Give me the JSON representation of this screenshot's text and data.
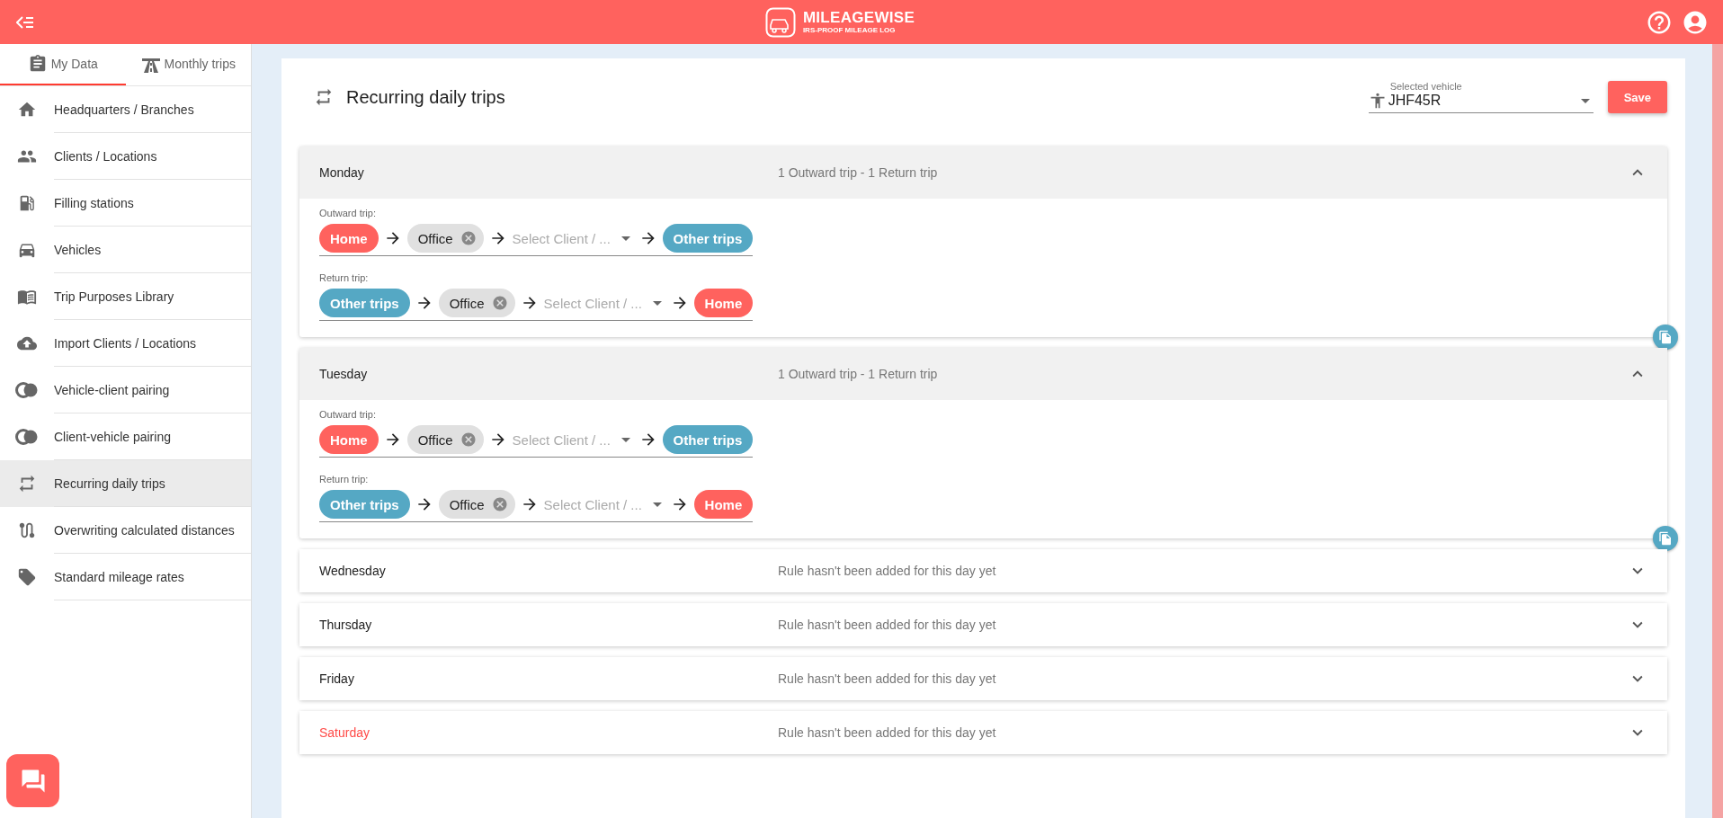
{
  "header": {
    "logo_name": "MILEAGEWISE",
    "logo_tagline": "IRS-PROOF MILEAGE LOG"
  },
  "sidebar": {
    "tabs": [
      {
        "label": "My Data",
        "selected": true
      },
      {
        "label": "Monthly trips",
        "selected": false
      }
    ],
    "items": [
      {
        "label": "Headquarters / Branches",
        "selected": false
      },
      {
        "label": "Clients / Locations",
        "selected": false
      },
      {
        "label": "Filling stations",
        "selected": false
      },
      {
        "label": "Vehicles",
        "selected": false
      },
      {
        "label": "Trip Purposes Library",
        "selected": false
      },
      {
        "label": "Import Clients / Locations",
        "selected": false
      },
      {
        "label": "Vehicle-client pairing",
        "selected": false
      },
      {
        "label": "Client-vehicle pairing",
        "selected": false
      },
      {
        "label": "Recurring daily trips",
        "selected": true
      },
      {
        "label": "Overwriting calculated distances",
        "selected": false
      },
      {
        "label": "Standard mileage rates",
        "selected": false
      }
    ]
  },
  "page": {
    "title": "Recurring daily trips",
    "vehicle": {
      "label": "Selected vehicle",
      "value": "JHF45R"
    },
    "save_button": "Save"
  },
  "days": [
    {
      "name": "Monday",
      "summary": "1 Outward trip - 1 Return trip",
      "expanded": true,
      "weekend": false,
      "trips": [
        {
          "label": "Outward trip:",
          "stops": [
            {
              "kind": "home",
              "text": "Home"
            },
            {
              "kind": "place",
              "text": "Office"
            },
            {
              "kind": "select",
              "text": "Select Client / ..."
            },
            {
              "kind": "other",
              "text": "Other trips"
            }
          ]
        },
        {
          "label": "Return trip:",
          "stops": [
            {
              "kind": "other",
              "text": "Other trips"
            },
            {
              "kind": "place",
              "text": "Office"
            },
            {
              "kind": "select",
              "text": "Select Client / ..."
            },
            {
              "kind": "home",
              "text": "Home"
            }
          ]
        }
      ]
    },
    {
      "name": "Tuesday",
      "summary": "1 Outward trip - 1 Return trip",
      "expanded": true,
      "weekend": false,
      "trips": [
        {
          "label": "Outward trip:",
          "stops": [
            {
              "kind": "home",
              "text": "Home"
            },
            {
              "kind": "place",
              "text": "Office"
            },
            {
              "kind": "select",
              "text": "Select Client / ..."
            },
            {
              "kind": "other",
              "text": "Other trips"
            }
          ]
        },
        {
          "label": "Return trip:",
          "stops": [
            {
              "kind": "other",
              "text": "Other trips"
            },
            {
              "kind": "place",
              "text": "Office"
            },
            {
              "kind": "select",
              "text": "Select Client / ..."
            },
            {
              "kind": "home",
              "text": "Home"
            }
          ]
        }
      ]
    },
    {
      "name": "Wednesday",
      "summary": "Rule hasn't been added for this day yet",
      "expanded": false,
      "weekend": false
    },
    {
      "name": "Thursday",
      "summary": "Rule hasn't been added for this day yet",
      "expanded": false,
      "weekend": false
    },
    {
      "name": "Friday",
      "summary": "Rule hasn't been added for this day yet",
      "expanded": false,
      "weekend": false
    },
    {
      "name": "Saturday",
      "summary": "Rule hasn't been added for this day yet",
      "expanded": false,
      "weekend": true
    }
  ]
}
